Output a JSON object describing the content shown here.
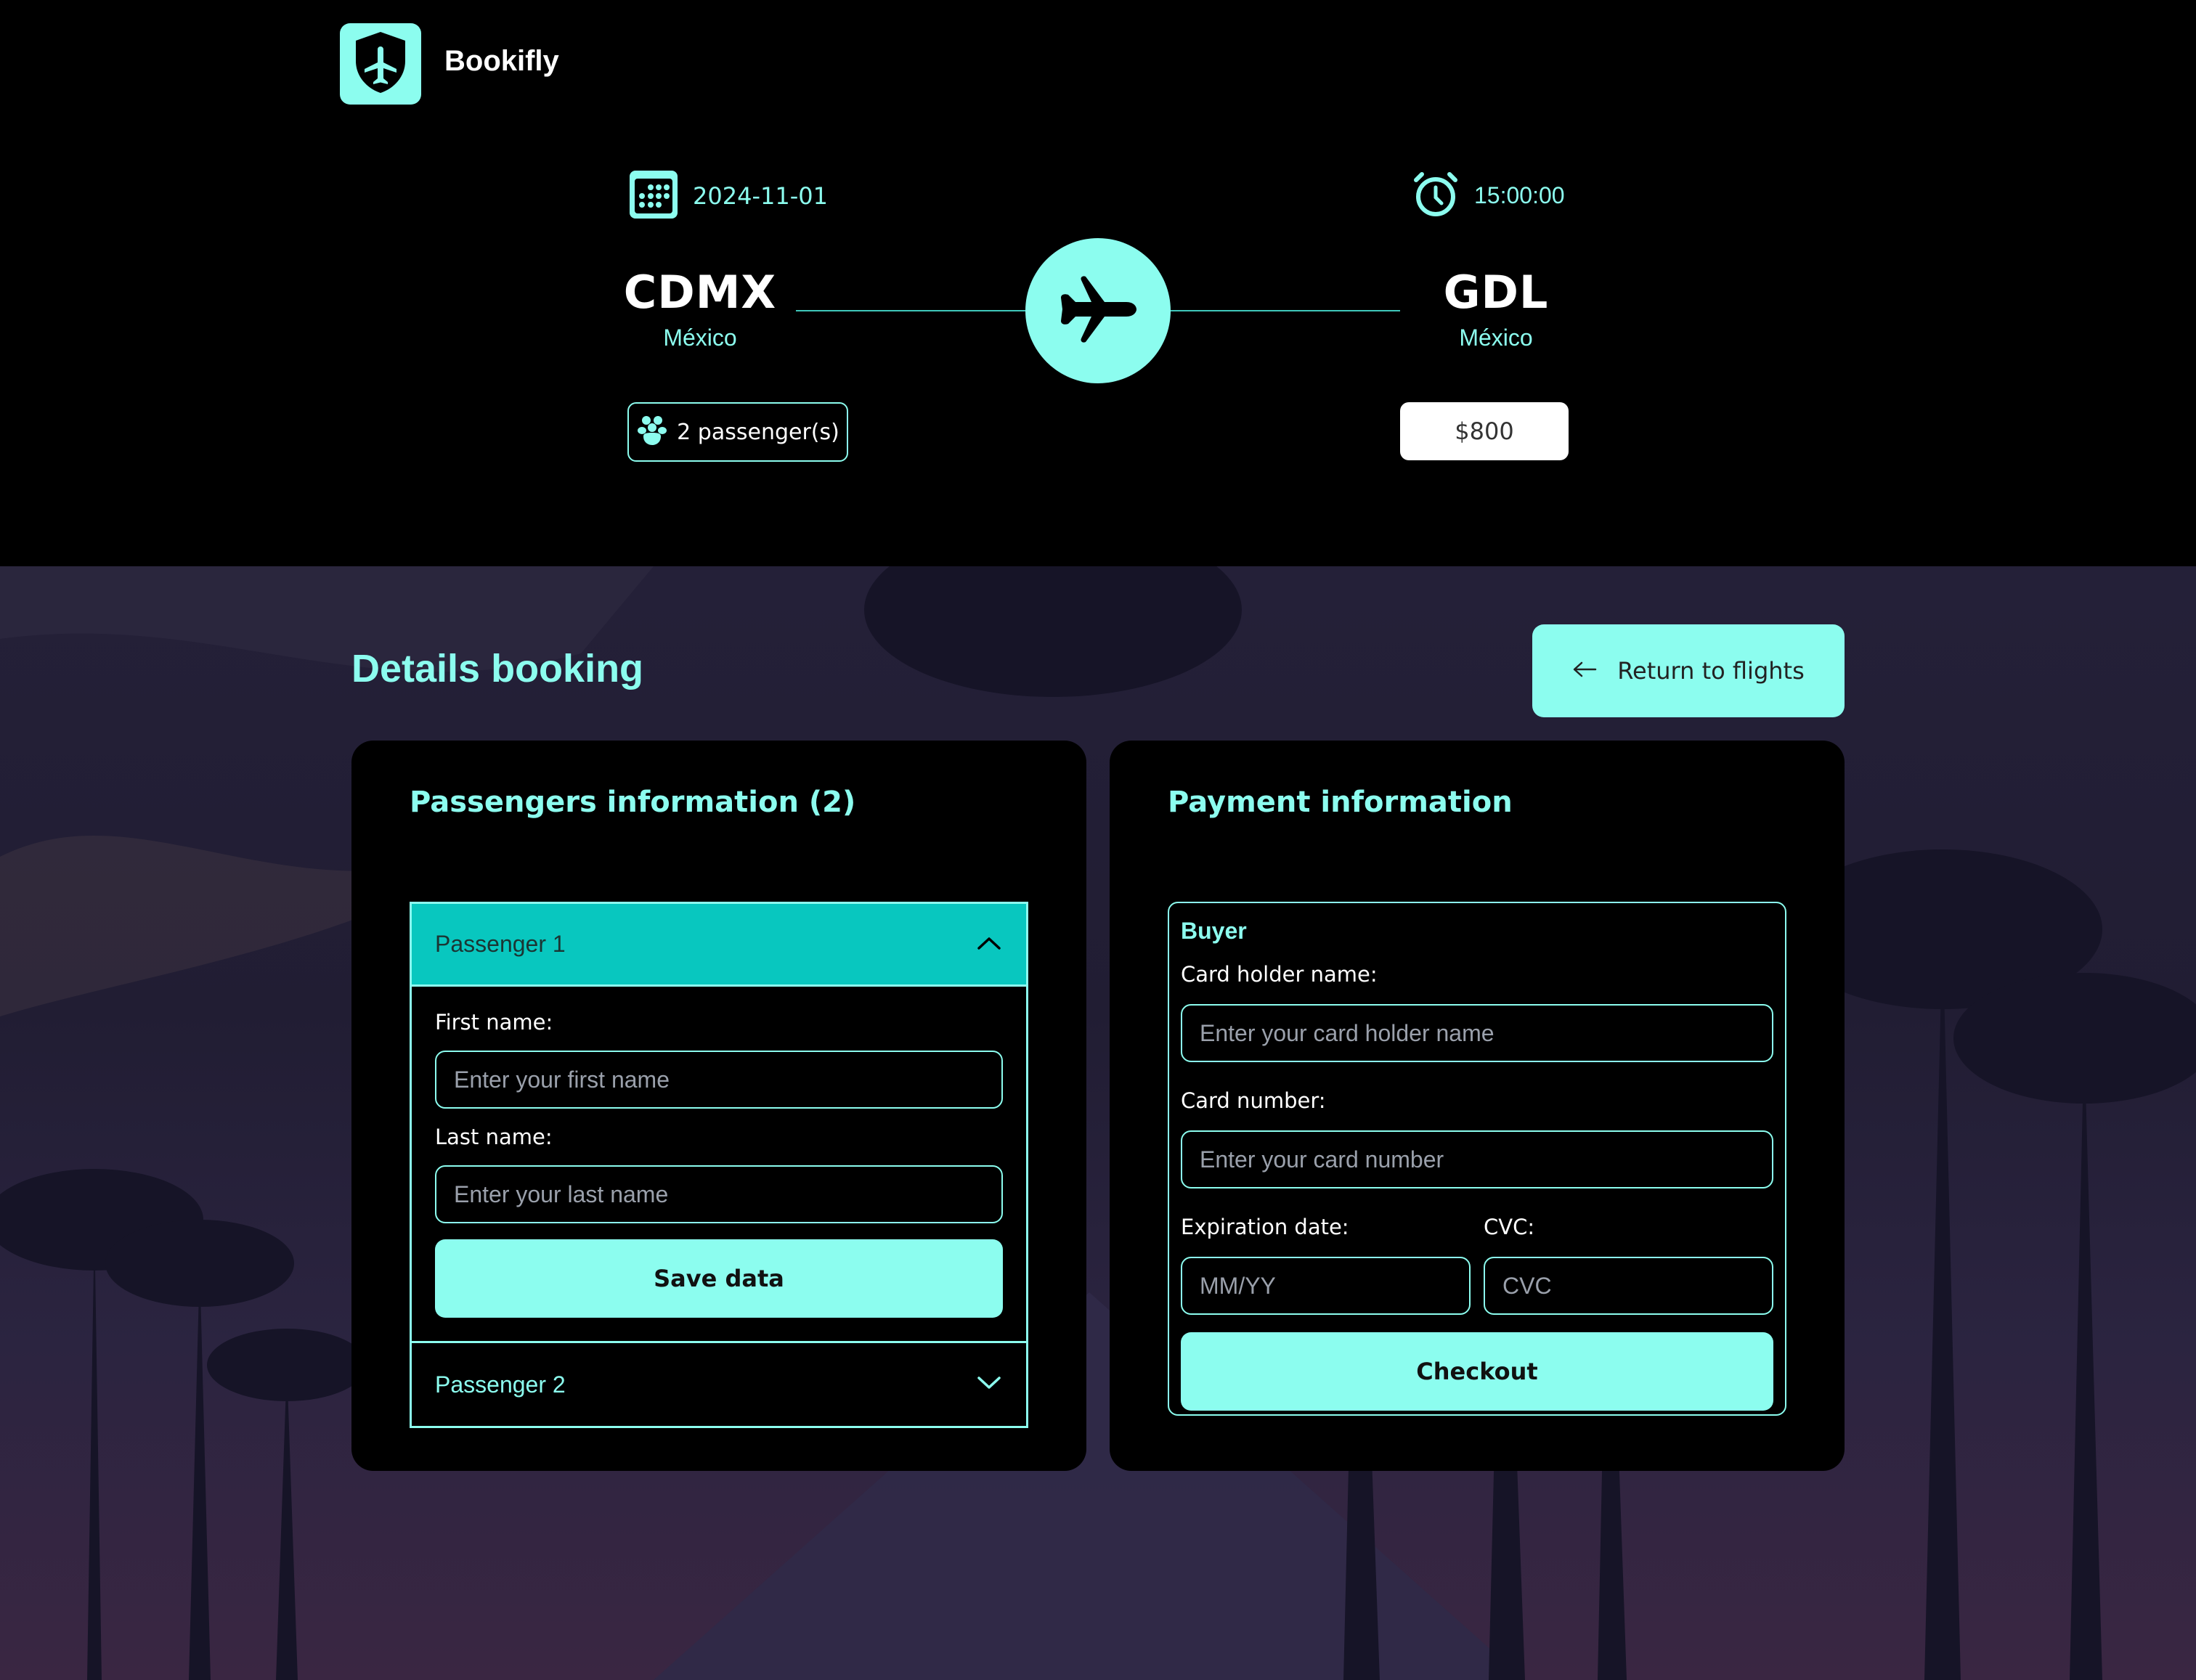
{
  "app": {
    "brand": "Bookifly"
  },
  "flight": {
    "date": "2024-11-01",
    "time": "15:00:00",
    "origin": {
      "code": "CDMX",
      "country": "México"
    },
    "destination": {
      "code": "GDL",
      "country": "México"
    },
    "passengers_label": "2 passenger(s)",
    "price": "$800"
  },
  "page": {
    "title": "Details booking",
    "return_button": "Return to flights"
  },
  "passengers": {
    "title": "Passengers information (2)",
    "items": [
      {
        "label": "Passenger 1",
        "expanded": true,
        "first_name_label": "First name:",
        "first_name_placeholder": "Enter your first name",
        "first_name_value": "",
        "last_name_label": "Last name:",
        "last_name_placeholder": "Enter your last name",
        "last_name_value": "",
        "save_button": "Save data"
      },
      {
        "label": "Passenger 2",
        "expanded": false
      }
    ]
  },
  "payment": {
    "title": "Payment information",
    "legend": "Buyer",
    "card_holder_label": "Card holder name:",
    "card_holder_placeholder": "Enter your card holder name",
    "card_number_label": "Card number:",
    "card_number_placeholder": "Enter your card number",
    "expiration_label": "Expiration date:",
    "expiration_placeholder": "MM/YY",
    "cvc_label": "CVC:",
    "cvc_placeholder": "CVC",
    "checkout_button": "Checkout"
  },
  "colors": {
    "accent": "#8cfdef",
    "accent_dark": "#08c7bf",
    "background": "#000000"
  }
}
